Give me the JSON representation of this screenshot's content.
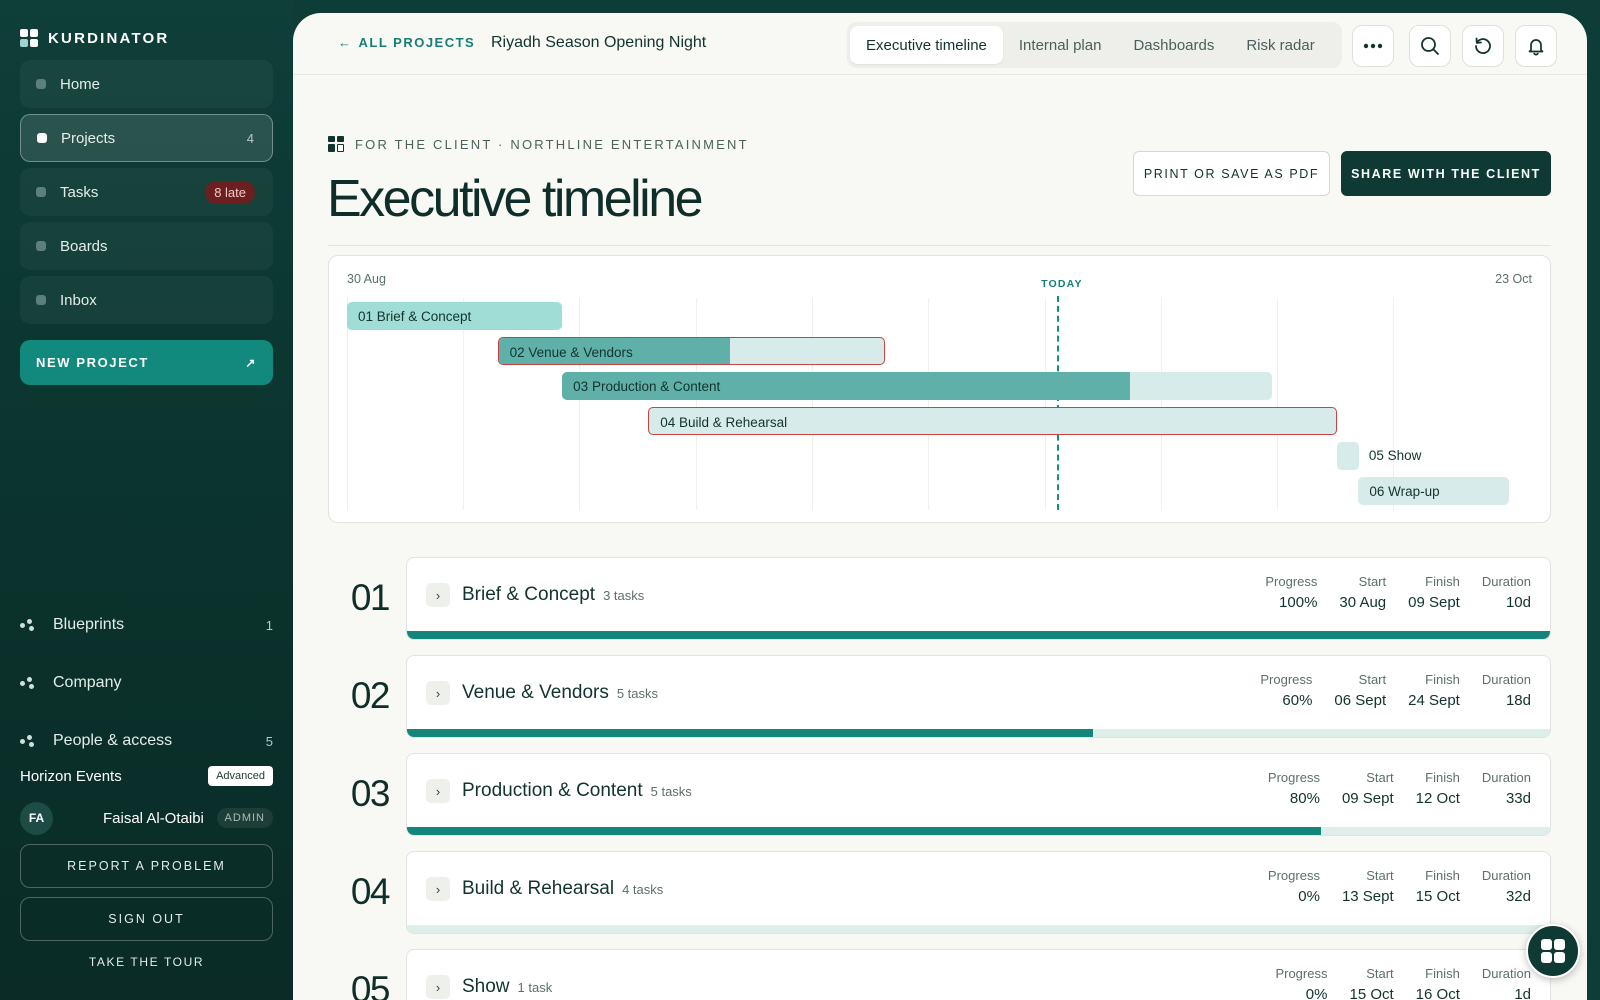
{
  "sidebar": {
    "brand": "KURDINATOR",
    "nav": [
      {
        "label": "Home",
        "count": "",
        "late": ""
      },
      {
        "label": "Projects",
        "count": "4",
        "late": ""
      },
      {
        "label": "Tasks",
        "count": "",
        "late": "8 late"
      },
      {
        "label": "Boards",
        "count": "",
        "late": ""
      },
      {
        "label": "Inbox",
        "count": "",
        "late": ""
      }
    ],
    "new_project": "NEW PROJECT",
    "links": [
      {
        "label": "Blueprints",
        "count": "1"
      },
      {
        "label": "Company",
        "count": ""
      },
      {
        "label": "People & access",
        "count": "5"
      }
    ],
    "org": {
      "name": "Horizon Events",
      "plan": "Advanced"
    },
    "user": {
      "initials": "FA",
      "name": "Faisal Al-Otaibi",
      "role": "ADMIN"
    },
    "report": "REPORT A PROBLEM",
    "signout": "SIGN OUT",
    "tour": "TAKE THE TOUR"
  },
  "topbar": {
    "back": "ALL PROJECTS",
    "project": "Riyadh Season Opening Night",
    "tabs": [
      "Executive timeline",
      "Internal plan",
      "Dashboards",
      "Risk radar"
    ],
    "active_tab": "Executive timeline"
  },
  "header": {
    "client_line": "FOR THE CLIENT · NORTHLINE ENTERTAINMENT",
    "title": "Executive timeline",
    "print": "PRINT OR SAVE AS PDF",
    "share": "SHARE WITH THE CLIENT"
  },
  "gantt": {
    "start_label": "30 Aug",
    "end_label": "23 Oct",
    "today_label": "TODAY",
    "today": "2024-10-02",
    "range": [
      "2024-08-30",
      "2024-10-23"
    ],
    "bars": [
      {
        "label": "01 Brief & Concept",
        "start": "2024-08-30",
        "finish": "2024-09-09",
        "progress": 1.0,
        "at_risk": false,
        "done": true
      },
      {
        "label": "02 Venue & Vendors",
        "start": "2024-09-06",
        "finish": "2024-09-24",
        "progress": 0.6,
        "at_risk": true,
        "done": false
      },
      {
        "label": "03 Production & Content",
        "start": "2024-09-09",
        "finish": "2024-10-12",
        "progress": 0.8,
        "at_risk": false,
        "done": false
      },
      {
        "label": "04 Build & Rehearsal",
        "start": "2024-09-13",
        "finish": "2024-10-15",
        "progress": 0.0,
        "at_risk": true,
        "done": false
      },
      {
        "label": "05 Show",
        "start": "2024-10-15",
        "finish": "2024-10-16",
        "progress": 0.0,
        "at_risk": false,
        "done": false
      },
      {
        "label": "06 Wrap-up",
        "start": "2024-10-16",
        "finish": "2024-10-23",
        "progress": 0.0,
        "at_risk": false,
        "done": false
      }
    ]
  },
  "metric_labels": {
    "progress": "Progress",
    "start": "Start",
    "finish": "Finish",
    "duration": "Duration"
  },
  "phases": [
    {
      "num": "01",
      "name": "Brief & Concept",
      "tasks": "3 tasks",
      "progress": "100%",
      "progress_value": 1.0,
      "start": "30 Aug",
      "finish": "09 Sept",
      "duration": "10d"
    },
    {
      "num": "02",
      "name": "Venue & Vendors",
      "tasks": "5 tasks",
      "progress": "60%",
      "progress_value": 0.6,
      "start": "06 Sept",
      "finish": "24 Sept",
      "duration": "18d"
    },
    {
      "num": "03",
      "name": "Production & Content",
      "tasks": "5 tasks",
      "progress": "80%",
      "progress_value": 0.8,
      "start": "09 Sept",
      "finish": "12 Oct",
      "duration": "33d"
    },
    {
      "num": "04",
      "name": "Build & Rehearsal",
      "tasks": "4 tasks",
      "progress": "0%",
      "progress_value": 0.0,
      "start": "13 Sept",
      "finish": "15 Oct",
      "duration": "32d"
    },
    {
      "num": "05",
      "name": "Show",
      "tasks": "1 task",
      "progress": "0%",
      "progress_value": 0.0,
      "start": "15 Oct",
      "finish": "16 Oct",
      "duration": "1d"
    }
  ],
  "colors": {
    "brand": "#0e3a33",
    "accent": "#11897c",
    "risk": "#c64343",
    "progress_fill": "#13857a"
  }
}
